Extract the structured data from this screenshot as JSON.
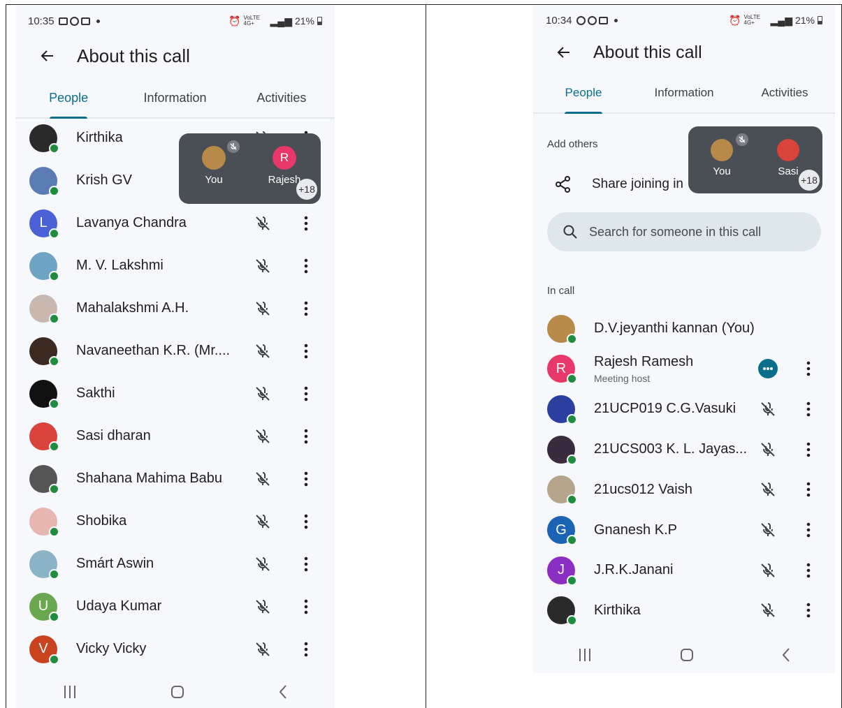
{
  "left": {
    "status": {
      "time": "10:35",
      "net": "VoLTE 4G+",
      "battery": "21%"
    },
    "title": "About this call",
    "tabs": [
      "People",
      "Information",
      "Activities"
    ],
    "pip": {
      "you_label": "You",
      "other_label": "Rajesh",
      "other_initial": "R",
      "more_count": "+18"
    },
    "participants": [
      {
        "name": "Kirthika",
        "initial": "",
        "color": "#2a2a2a"
      },
      {
        "name": "Krish GV",
        "initial": "",
        "color": "#5b7bb5"
      },
      {
        "name": "Lavanya Chandra",
        "initial": "L",
        "color": "#4a62d6"
      },
      {
        "name": "M. V. Lakshmi",
        "initial": "",
        "color": "#6fa3c4"
      },
      {
        "name": "Mahalakshmi A.H.",
        "initial": "",
        "color": "#c9b8b0"
      },
      {
        "name": "Navaneethan K.R. (Mr....",
        "initial": "",
        "color": "#3a2a22"
      },
      {
        "name": "Sakthi",
        "initial": "",
        "color": "#111111"
      },
      {
        "name": "Sasi dharan",
        "initial": "",
        "color": "#d9433b"
      },
      {
        "name": "Shahana Mahima Babu",
        "initial": "",
        "color": "#555555"
      },
      {
        "name": "Shobika",
        "initial": "",
        "color": "#e6b7b0"
      },
      {
        "name": "Smárt Aswin",
        "initial": "",
        "color": "#8ab3c8"
      },
      {
        "name": "Udaya Kumar",
        "initial": "U",
        "color": "#6aa84f"
      },
      {
        "name": "Vicky Vicky",
        "initial": "V",
        "color": "#c8431e"
      }
    ]
  },
  "right": {
    "status": {
      "time": "10:34",
      "net": "VoLTE 4G+",
      "battery": "21%"
    },
    "title": "About this call",
    "tabs": [
      "People",
      "Information",
      "Activities"
    ],
    "add_others": "Add others",
    "share_text": "Share joining in",
    "search_placeholder": "Search for someone in this call",
    "in_call": "In call",
    "pip": {
      "you_label": "You",
      "other_label": "Sasi",
      "more_count": "+18"
    },
    "participants": [
      {
        "name": "D.V.jeyanthi kannan (You)",
        "initial": "",
        "color": "#b88a4a",
        "sub": ""
      },
      {
        "name": "Rajesh Ramesh",
        "initial": "R",
        "color": "#e8386a",
        "sub": "Meeting host"
      },
      {
        "name": "21UCP019 C.G.Vasuki",
        "initial": "",
        "color": "#2a3fa0",
        "sub": ""
      },
      {
        "name": "21UCS003 K. L. Jayas...",
        "initial": "",
        "color": "#3a2c3e",
        "sub": ""
      },
      {
        "name": "21ucs012 Vaish",
        "initial": "",
        "color": "#b5a58c",
        "sub": ""
      },
      {
        "name": "Gnanesh K.P",
        "initial": "G",
        "color": "#1a63b5",
        "sub": ""
      },
      {
        "name": "J.R.K.Janani",
        "initial": "J",
        "color": "#8a2fc1",
        "sub": ""
      },
      {
        "name": "Kirthika",
        "initial": "",
        "color": "#2a2a2a",
        "sub": ""
      }
    ]
  }
}
